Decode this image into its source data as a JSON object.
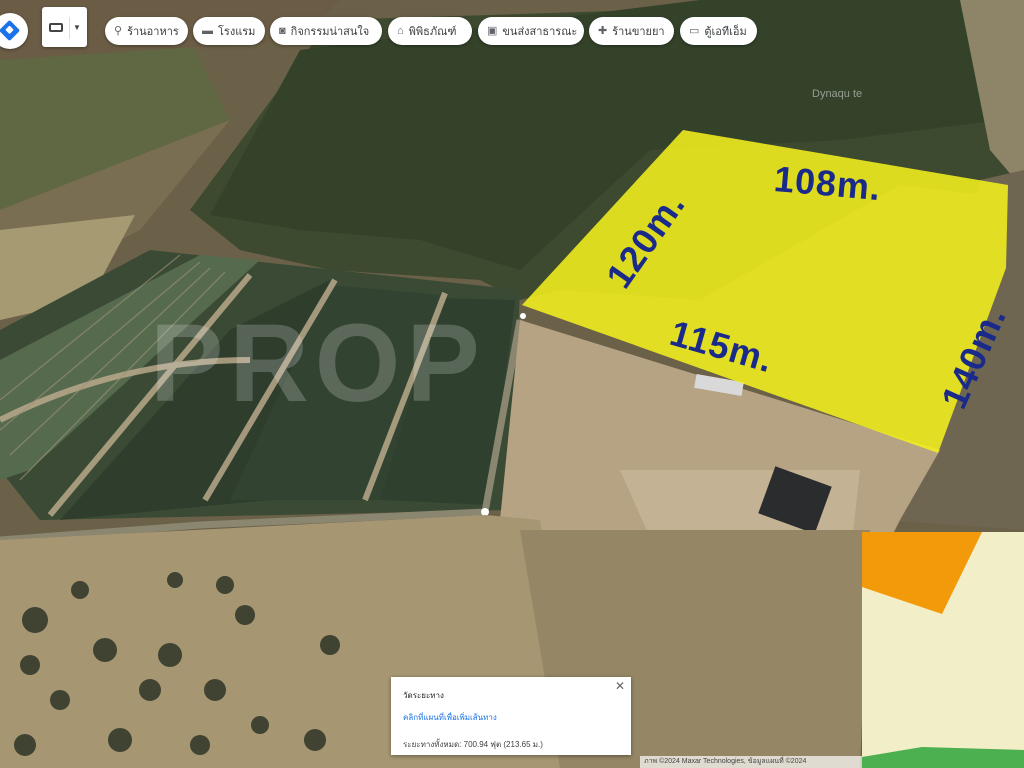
{
  "toolbar": {
    "chips": [
      {
        "label": "ร้านอาหาร",
        "icon": "fork-knife-icon",
        "glyph": "⚲"
      },
      {
        "label": "โรงแรม",
        "icon": "bed-icon",
        "glyph": "▬"
      },
      {
        "label": "กิจกรรมน่าสนใจ",
        "icon": "camera-icon",
        "glyph": "◙"
      },
      {
        "label": "พิพิธภัณฑ์",
        "icon": "museum-icon",
        "glyph": "⌂"
      },
      {
        "label": "ขนส่งสาธารณะ",
        "icon": "bus-icon",
        "glyph": "▣"
      },
      {
        "label": "ร้านขายยา",
        "icon": "pharmacy-icon",
        "glyph": "✚"
      },
      {
        "label": "ตู้เอทีเอ็ม",
        "icon": "atm-icon",
        "glyph": "▭"
      }
    ]
  },
  "map": {
    "dimensions": {
      "top": "108m.",
      "left": "120m.",
      "bottom": "115m.",
      "right": "140m."
    },
    "watermark": "PROP",
    "faint_label": "Dynaqu te",
    "plot_color": "#f2ef1e",
    "label_color": "#1a2a8a"
  },
  "info_card": {
    "title": "วัดระยะทาง",
    "subtitle": "คลิกที่แผนที่เพื่อเพิ่มเส้นทาง",
    "measure": "ระยะทางทั้งหมด: 700.94 ฟุต (213.65 ม.)",
    "close_glyph": "✕"
  },
  "minimap": {
    "accent": "#f39a0b"
  },
  "footer": {
    "attribution": "ภาพ ©2024 Maxar Technologies, ข้อมูลแผนที่ ©2024"
  }
}
